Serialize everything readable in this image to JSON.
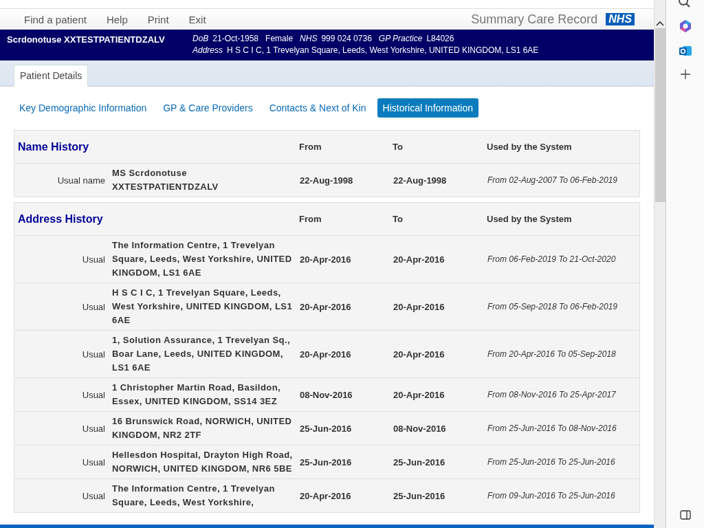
{
  "menu": [
    {
      "label": "Find a patient"
    },
    {
      "label": "Help"
    },
    {
      "label": "Print"
    },
    {
      "label": "Exit"
    }
  ],
  "app_title": "Summary Care Record",
  "logo": "NHS",
  "patient": {
    "name": "Scrdonotuse XXTESTPATIENTDZALV",
    "fields": [
      {
        "label": "DoB",
        "value": "21-Oct-1958"
      },
      {
        "value": "Female"
      },
      {
        "label": "NHS",
        "value": "999 024 0736"
      },
      {
        "label": "GP Practice",
        "value": "L84026"
      }
    ],
    "address_label": "Address",
    "address": "H S C I C, 1 Trevelyan Square, Leeds, West Yorkshire, UNITED KINGDOM, LS1 6AE"
  },
  "tabs": [
    {
      "label": "Patient Details",
      "selected": true
    }
  ],
  "subtabs": [
    {
      "label": "Key Demographic Information",
      "selected": false
    },
    {
      "label": "GP & Care Providers",
      "selected": false
    },
    {
      "label": "Contacts & Next of Kin",
      "selected": false
    },
    {
      "label": "Historical Information",
      "selected": true
    }
  ],
  "sections": [
    {
      "title": "Name History",
      "columns": [
        "From",
        "To",
        "Used by the System"
      ],
      "rows": [
        {
          "type": "Usual name",
          "value": "MS Scrdonotuse XXTESTPATIENTDZALV",
          "from": "22-Aug-1998",
          "to": "22-Aug-1998",
          "used": "From 02-Aug-2007 To 06-Feb-2019"
        }
      ]
    },
    {
      "title": "Address History",
      "columns": [
        "From",
        "To",
        "Used by the System"
      ],
      "rows": [
        {
          "type": "Usual",
          "value": "The Information Centre, 1 Trevelyan Square, Leeds, West Yorkshire, UNITED KINGDOM, LS1 6AE",
          "from": "20-Apr-2016",
          "to": "20-Apr-2016",
          "used": "From 06-Feb-2019 To 21-Oct-2020"
        },
        {
          "type": "Usual",
          "value": "H S C I C, 1 Trevelyan Square, Leeds, West Yorkshire, UNITED KINGDOM, LS1 6AE",
          "from": "20-Apr-2016",
          "to": "20-Apr-2016",
          "used": "From 05-Sep-2018 To 06-Feb-2019"
        },
        {
          "type": "Usual",
          "value": "1, Solution Assurance, 1 Trevelyan Sq., Boar Lane, Leeds, UNITED KINGDOM, LS1 6AE",
          "from": "20-Apr-2016",
          "to": "20-Apr-2016",
          "used": "From 20-Apr-2016 To 05-Sep-2018"
        },
        {
          "type": "Usual",
          "value": "1 Christopher Martin Road, Basildon, Essex, UNITED KINGDOM, SS14 3EZ",
          "from": "08-Nov-2016",
          "to": "20-Apr-2016",
          "used": "From 08-Nov-2016 To 25-Apr-2017"
        },
        {
          "type": "Usual",
          "value": "16 Brunswick Road, NORWICH, UNITED KINGDOM, NR2 2TF",
          "from": "25-Jun-2016",
          "to": "08-Nov-2016",
          "used": "From 25-Jun-2016 To 08-Nov-2016"
        },
        {
          "type": "Usual",
          "value": "Hellesdon Hospital, Drayton High Road, NORWICH, UNITED KINGDOM, NR6 5BE",
          "from": "25-Jun-2016",
          "to": "25-Jun-2016",
          "used": "From 25-Jun-2016 To 25-Jun-2016"
        },
        {
          "type": "Usual",
          "value": "The Information Centre, 1 Trevelyan Square, Leeds, West Yorkshire,",
          "from": "20-Apr-2016",
          "to": "25-Jun-2016",
          "used": "From 09-Jun-2016 To 25-Jun-2016"
        }
      ]
    }
  ]
}
